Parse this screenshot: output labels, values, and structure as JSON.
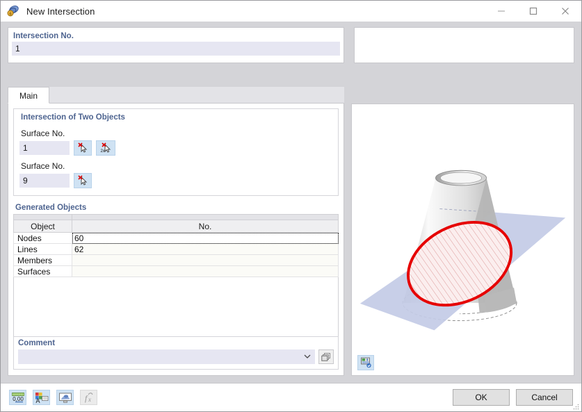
{
  "window": {
    "title": "New Intersection",
    "icon": "intersection-icon",
    "minimize_label": "–",
    "maximize_label": "□",
    "close_label": "✕"
  },
  "intersection_no": {
    "label": "Intersection No.",
    "value": "1"
  },
  "tabs": [
    {
      "label": "Main",
      "active": true
    }
  ],
  "intersection_of_two_objects": {
    "label": "Intersection of Two Objects",
    "surface1": {
      "label": "Surface No.",
      "value": "1",
      "pick_single_icon": "pick-single-icon",
      "pick_multiple_icon": "pick-multiple-icon"
    },
    "surface2": {
      "label": "Surface No.",
      "value": "9",
      "pick_single_icon": "pick-single-icon"
    }
  },
  "generated_objects": {
    "label": "Generated Objects",
    "columns": [
      "Object",
      "No."
    ],
    "rows": [
      {
        "object": "Nodes",
        "no": "60"
      },
      {
        "object": "Lines",
        "no": "62"
      },
      {
        "object": "Members",
        "no": ""
      },
      {
        "object": "Surfaces",
        "no": ""
      }
    ]
  },
  "comment": {
    "label": "Comment",
    "value": "",
    "placeholder": "",
    "dropdown_icon": "chevron-down-icon",
    "library_icon": "comment-library-icon"
  },
  "graphic": {
    "description": "3D view of a truncated cone intersected by a plane producing a red hatched ellipse",
    "render_icon": "render-settings-icon",
    "colors": {
      "plane": "#c3cbe6",
      "intersection_outline": "#e60000",
      "intersection_fill": "#fbeeee",
      "cone_light": "#fafafa",
      "cone_dark": "#a9a9a9"
    }
  },
  "footer": {
    "tools": [
      {
        "name": "decimal-places-icon",
        "label": "0,00",
        "disabled": false
      },
      {
        "name": "display-properties-icon",
        "label": "A",
        "disabled": false
      },
      {
        "name": "visibility-icon",
        "label": "",
        "disabled": false
      },
      {
        "name": "formula-icon",
        "label": "fₓ",
        "disabled": true
      }
    ],
    "ok_label": "OK",
    "cancel_label": "Cancel"
  }
}
